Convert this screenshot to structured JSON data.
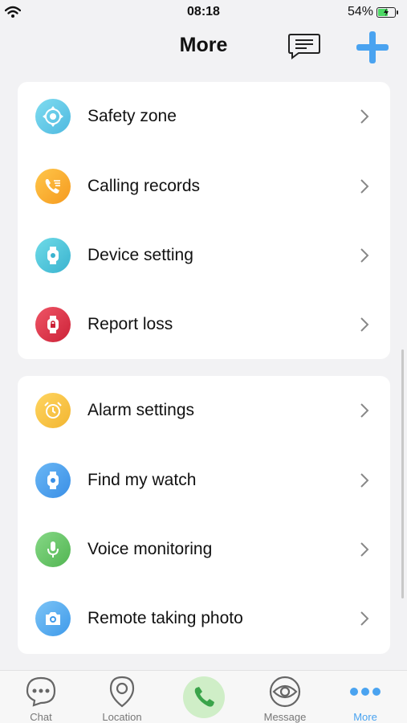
{
  "status": {
    "time": "08:18",
    "battery": "54%",
    "battery_level": 0.54
  },
  "header": {
    "title": "More"
  },
  "section1": {
    "items": [
      {
        "label": "Safety zone",
        "icon": "target-icon",
        "color": "#5ac8e8"
      },
      {
        "label": "Calling records",
        "icon": "phone-list-icon",
        "color": "#f5a623"
      },
      {
        "label": "Device setting",
        "icon": "watch-icon",
        "color": "#4fc3d9"
      },
      {
        "label": "Report loss",
        "icon": "lock-watch-icon",
        "color": "#e0354a"
      }
    ]
  },
  "section2": {
    "items": [
      {
        "label": "Alarm settings",
        "icon": "alarm-clock-icon",
        "color": "#f6c542"
      },
      {
        "label": "Find my watch",
        "icon": "watch-icon",
        "color": "#4a9df0"
      },
      {
        "label": "Voice monitoring",
        "icon": "microphone-icon",
        "color": "#6cc96c"
      },
      {
        "label": "Remote taking photo",
        "icon": "camera-icon",
        "color": "#5aaef0"
      }
    ]
  },
  "tabs": [
    {
      "label": "Chat",
      "icon": "chat-bubble-icon"
    },
    {
      "label": "Location",
      "icon": "location-pin-icon"
    },
    {
      "label": "Message",
      "icon": "eye-icon"
    },
    {
      "label": "More",
      "icon": "more-dots-icon",
      "active": true
    }
  ],
  "colors": {
    "accent": "#4aa3f0",
    "call_bg": "#cfeec7",
    "call_icon": "#3aa44a"
  }
}
